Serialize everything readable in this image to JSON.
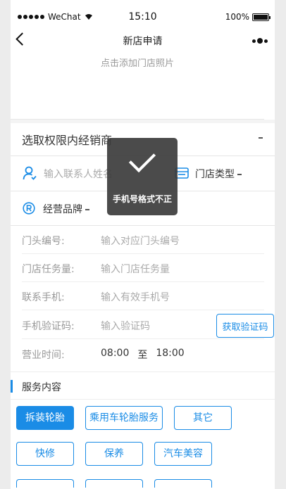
{
  "statusbar": {
    "carrier": "WeChat",
    "time": "15:10",
    "battery": "100%"
  },
  "nav": {
    "title": "新店申请"
  },
  "photo": {
    "hint": "点击添加门店照片"
  },
  "dealer": {
    "label": "选取权限内经销商"
  },
  "contact": {
    "placeholder": "输入联系人姓名"
  },
  "store_type": {
    "label": "门店类型"
  },
  "brand": {
    "label": "经营品牌"
  },
  "form": {
    "door_no": {
      "label": "门头编号:",
      "placeholder": "输入对应门头编号"
    },
    "tasks": {
      "label": "门店任务量:",
      "placeholder": "输入门店任务量"
    },
    "phone": {
      "label": "联系手机:",
      "placeholder": "输入有效手机号"
    },
    "code": {
      "label": "手机验证码:",
      "placeholder": "输入验证码",
      "button": "获取验证码"
    },
    "hours": {
      "label": "营业时间:",
      "open": "08:00",
      "sep": "至",
      "close": "18:00"
    }
  },
  "services": {
    "title": "服务内容",
    "options": [
      "拆装轮胎",
      "乘用车轮胎服务",
      "其它",
      "快修",
      "保养",
      "汽车美容"
    ],
    "selected": "拆装轮胎"
  },
  "toast": {
    "message": "手机号格式不正"
  },
  "colors": {
    "accent": "#1a8ce6"
  }
}
